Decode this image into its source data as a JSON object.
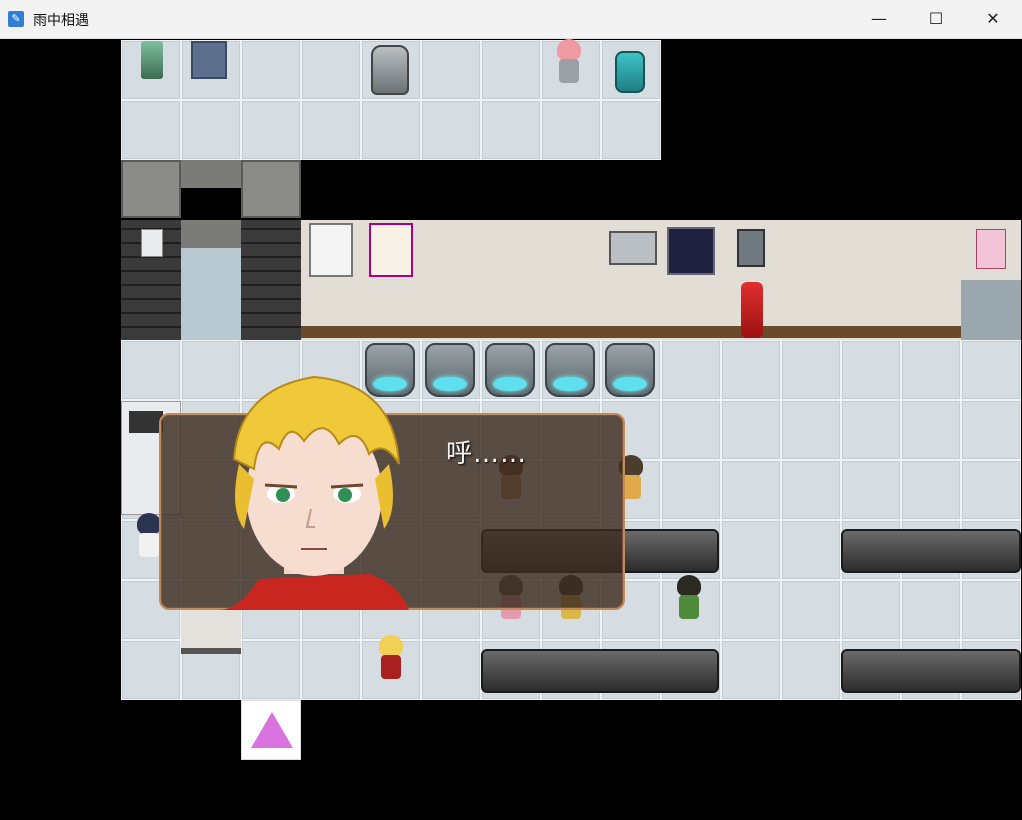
{
  "window": {
    "title": "雨中相遇",
    "minimize_glyph": "—",
    "maximize_glyph": "☐",
    "close_glyph": "✕"
  },
  "dialog": {
    "text": "呼……",
    "speaker_portrait": "blond-boy-red-scarf-portrait"
  },
  "map": {
    "scene": "hospital-waiting-room",
    "exit_marker_icon": "pink-up-arrow-icon",
    "continue_indicator": "••"
  },
  "colors": {
    "dialog_border": "#c48b5a",
    "exit_arrow": "#d873e0",
    "chair_glow": "#5fe0f0"
  }
}
